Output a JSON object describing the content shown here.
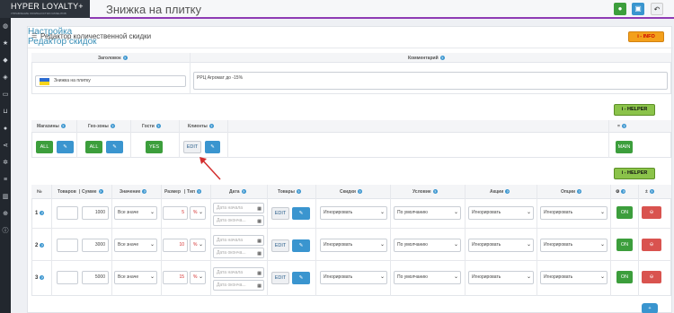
{
  "brand": {
    "title": "HYPER LOYALTY+",
    "subtitle": "УПРАВЛЕНИЕ ЛОЯЛЬНОСТЬЮ КЛИЕНТОВ"
  },
  "page": {
    "title": "Знижка на плитку"
  },
  "toolbar": {
    "colors": {
      "save": "#3c9e3c",
      "save2": "#3a95cf",
      "back": "#eef0f3"
    }
  },
  "panel": {
    "title": "Редактор количественной скидки",
    "info_label": "i - INFO"
  },
  "meta": {
    "header_label": "Заголовок",
    "comment_label": "Комментарий",
    "header_value": "Знижка на плитку",
    "comment_value": "РРЦ Агромат до -15%"
  },
  "settings": {
    "title": "Настройка",
    "helper_label": "i - HELPER",
    "headers": {
      "stores": "Магазины",
      "geo": "Гео-зоны",
      "guests": "Гости",
      "clients": "Клиенты",
      "equals": "="
    },
    "stores_btn": "ALL",
    "geo_btn": "ALL",
    "guests_btn": "YES",
    "clients_btn": "EDIT",
    "main_btn": "MAIN"
  },
  "editor": {
    "title": "Редактор скидок",
    "helper_label": "i - HELPER",
    "headers": {
      "no": "№",
      "goods": "Товаров",
      "sum": "Сумме",
      "value": "Значение",
      "size": "Размер",
      "type": "Тип",
      "date": "Дата",
      "products": "Товары",
      "discounts": "Скидки",
      "condition": "Условие",
      "actions": "Акции",
      "options": "Опции",
      "plus": "±"
    },
    "date_from_ph": "Дата начала",
    "date_to_ph": "Дата оконча...",
    "rows": [
      {
        "no": "1",
        "goods": "",
        "sum": "1000",
        "value": "Все значе",
        "size": "5",
        "type": "%",
        "edit": "EDIT",
        "discount": "Игнорировать",
        "condition": "По умолчанию",
        "action": "Игнорировать",
        "option": "Игнорировать",
        "status": "ON"
      },
      {
        "no": "2",
        "goods": "",
        "sum": "3000",
        "value": "Все значе",
        "size": "10",
        "type": "%",
        "edit": "EDIT",
        "discount": "Игнорировать",
        "condition": "По умолчанию",
        "action": "Игнорировать",
        "option": "Игнорировать",
        "status": "ON"
      },
      {
        "no": "3",
        "goods": "",
        "sum": "5000",
        "value": "Все значе",
        "size": "15",
        "type": "%",
        "edit": "EDIT",
        "discount": "Игнорировать",
        "condition": "По умолчанию",
        "action": "Игнорировать",
        "option": "Игнорировать",
        "status": "ON"
      }
    ]
  }
}
